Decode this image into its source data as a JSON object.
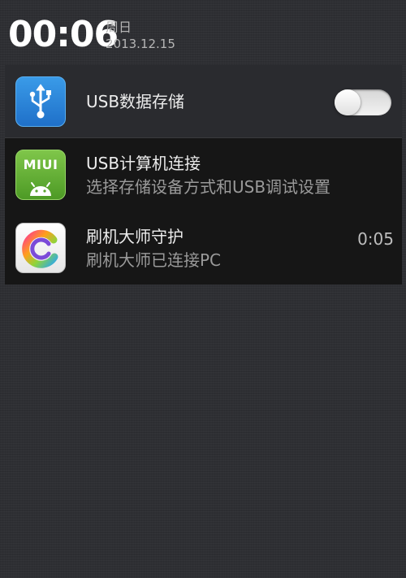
{
  "status": {
    "time": "00:06",
    "weekday": "周日",
    "date": "2013.12.15"
  },
  "notifications": [
    {
      "title": "USB数据存储",
      "icon": "usb-icon",
      "toggle_on": false
    },
    {
      "title": "USB计算机连接",
      "subtitle": "选择存储设备方式和USB调试设置",
      "icon": "miui-android-icon",
      "badge_text": "MIUI"
    },
    {
      "title": "刷机大师守护",
      "subtitle": "刷机大师已连接PC",
      "time": "0:05",
      "icon": "shuaji-dashi-icon"
    }
  ],
  "colors": {
    "usb_icon_bg": "#2b86dc",
    "miui_icon_bg": "#64b236",
    "background": "#2e2f33"
  }
}
